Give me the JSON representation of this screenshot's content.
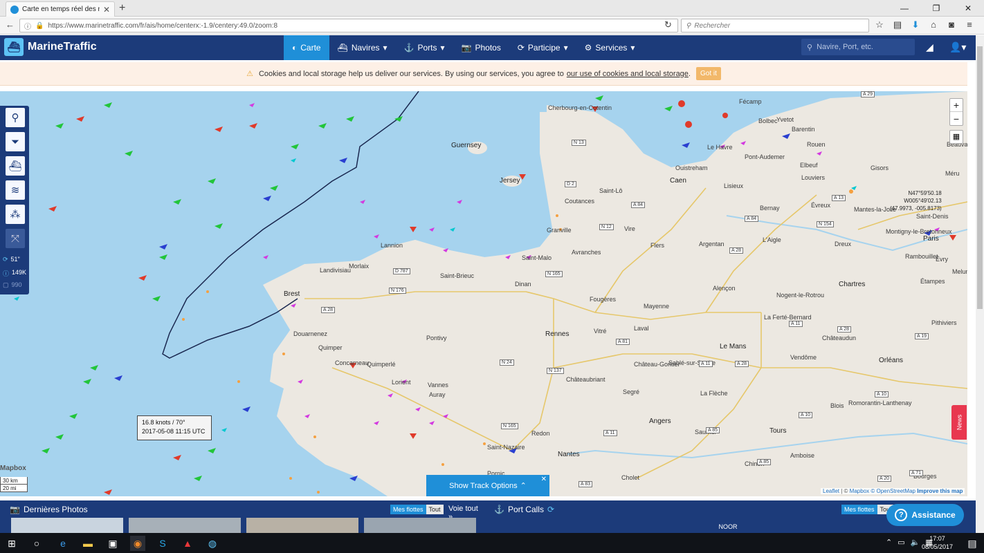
{
  "browser": {
    "tab_title": "Carte en temps réel des navi",
    "tab_close": "✕",
    "new_tab": "+",
    "url": "https://www.marinetraffic.com/fr/ais/home/centerx:-1.9/centery:49.0/zoom:8",
    "search_placeholder": "Rechercher"
  },
  "header": {
    "brand": "MarineTraffic",
    "menu": [
      "Carte",
      "Navires",
      "Ports",
      "Photos",
      "Participe",
      "Services"
    ],
    "search_placeholder": "Navire, Port, etc."
  },
  "cookie": {
    "text": "Cookies and local storage help us deliver our services. By using our services, you agree to",
    "link": "our use of cookies and local storage",
    "dot": ".",
    "button": "Got it"
  },
  "left_stats": {
    "refresh": "51\"",
    "vessels": "149K",
    "other": "990"
  },
  "map": {
    "coords_line1": "N47°59'50.18",
    "coords_line2": "W005°49'02.13",
    "coords_line3": "(47.9973, -005.8173)",
    "zoom_in": "+",
    "zoom_out": "−",
    "tooltip_line1": "16.8 knots / 70°",
    "tooltip_line2": "2017-05-08 11:15 UTC",
    "news": "News",
    "scale_km": "30 km",
    "scale_mi": "20 mi",
    "mapbox": "Mapbox",
    "attrib_leaflet": "Leaflet",
    "attrib_sep": " | © ",
    "attrib_mapbox": "Mapbox",
    "attrib_osm": "© OpenStreetMap",
    "attrib_improve": "Improve this map",
    "places": [
      {
        "name": "Guernsey",
        "cls": "big"
      },
      {
        "name": "Jersey",
        "cls": "big"
      },
      {
        "name": "Cherbourg-en-Cotentin"
      },
      {
        "name": "Fécamp"
      },
      {
        "name": "Bolbec"
      },
      {
        "name": "Yvetot"
      },
      {
        "name": "Barentin"
      },
      {
        "name": "Rouen"
      },
      {
        "name": "Beauvais"
      },
      {
        "name": "Le Havre"
      },
      {
        "name": "Pont-Audemer"
      },
      {
        "name": "Elbeuf"
      },
      {
        "name": "Gisors"
      },
      {
        "name": "Méru"
      },
      {
        "name": "Louviers"
      },
      {
        "name": "Évreux"
      },
      {
        "name": "Mantes-la-Jolie"
      },
      {
        "name": "Saint-Denis"
      },
      {
        "name": "Paris",
        "cls": "big"
      },
      {
        "name": "Montigny-le-Bretonneux"
      },
      {
        "name": "Évry"
      },
      {
        "name": "Rambouillet"
      },
      {
        "name": "Étampes"
      },
      {
        "name": "Dreux"
      },
      {
        "name": "Chartres",
        "cls": "big"
      },
      {
        "name": "Nogent-le-Rotrou"
      },
      {
        "name": "La Ferté-Bernard"
      },
      {
        "name": "Pithiviers"
      },
      {
        "name": "Melun"
      },
      {
        "name": "Châteaudun"
      },
      {
        "name": "Orléans",
        "cls": "big"
      },
      {
        "name": "Vendôme"
      },
      {
        "name": "Blois"
      },
      {
        "name": "Romorantin-Lanthenay"
      },
      {
        "name": "Tours",
        "cls": "big"
      },
      {
        "name": "Amboise"
      },
      {
        "name": "Chinon"
      },
      {
        "name": "Bourges"
      },
      {
        "name": "Le Mans",
        "cls": "big"
      },
      {
        "name": "Alençon"
      },
      {
        "name": "L'Aigle"
      },
      {
        "name": "Bernay"
      },
      {
        "name": "Lisieux"
      },
      {
        "name": "Caen",
        "cls": "big"
      },
      {
        "name": "Ouistreham"
      },
      {
        "name": "Argentan"
      },
      {
        "name": "Flers"
      },
      {
        "name": "Vire"
      },
      {
        "name": "Saint-Lô"
      },
      {
        "name": "Coutances"
      },
      {
        "name": "Granville"
      },
      {
        "name": "Avranches"
      },
      {
        "name": "Fougères"
      },
      {
        "name": "Mayenne"
      },
      {
        "name": "Laval"
      },
      {
        "name": "Vitré"
      },
      {
        "name": "Rennes",
        "cls": "big"
      },
      {
        "name": "Château-Gontier"
      },
      {
        "name": "Sablé-sur-Sarthe"
      },
      {
        "name": "La Flèche"
      },
      {
        "name": "Segré"
      },
      {
        "name": "Angers",
        "cls": "big"
      },
      {
        "name": "Saumur"
      },
      {
        "name": "Châteaubriant"
      },
      {
        "name": "Redon"
      },
      {
        "name": "Nantes",
        "cls": "big"
      },
      {
        "name": "Cholet"
      },
      {
        "name": "Saint-Nazaire"
      },
      {
        "name": "Pornic"
      },
      {
        "name": "Vannes"
      },
      {
        "name": "Auray"
      },
      {
        "name": "Lorient"
      },
      {
        "name": "Quimperlé"
      },
      {
        "name": "Concarneau"
      },
      {
        "name": "Quimper"
      },
      {
        "name": "Douarnenez"
      },
      {
        "name": "Brest",
        "cls": "big"
      },
      {
        "name": "Landivisiau"
      },
      {
        "name": "Morlaix"
      },
      {
        "name": "Lannion"
      },
      {
        "name": "Saint-Brieuc"
      },
      {
        "name": "Saint-Malo"
      },
      {
        "name": "Dinan"
      },
      {
        "name": "Pontivy"
      }
    ],
    "roads": [
      "A 29",
      "N 13",
      "D 2",
      "A 84",
      "N 12",
      "D 787",
      "N 176",
      "N 165",
      "A 28",
      "A 84",
      "N 154",
      "A 13",
      "A 28",
      "A 11",
      "A 11",
      "A 28",
      "A 81",
      "N 24",
      "N 137",
      "N 165",
      "A 11",
      "A 85",
      "A 85",
      "A 10",
      "A 19",
      "A 10",
      "A 20",
      "A 71",
      "A 83",
      "A 28"
    ]
  },
  "track": {
    "label": "Show Track Options",
    "close": "✕"
  },
  "photos": {
    "title": "Dernières Photos",
    "mes_flottes": "Mes flottes",
    "tout": "Tout",
    "voir_tout": "Voie tout »"
  },
  "portcalls": {
    "title": "Port Calls",
    "mes_flottes": "Mes flottes",
    "tout": "Tout",
    "row": "NOOR"
  },
  "assistance": "Assistance",
  "taskbar": {
    "time": "17:07",
    "date": "08/05/2017"
  }
}
